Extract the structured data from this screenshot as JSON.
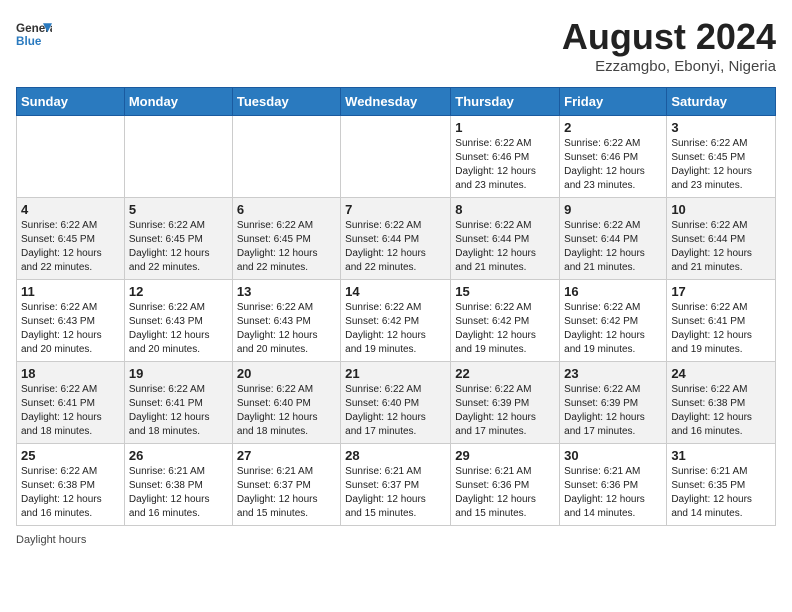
{
  "header": {
    "logo_line1": "General",
    "logo_line2": "Blue",
    "title": "August 2024",
    "subtitle": "Ezzamgbo, Ebonyi, Nigeria"
  },
  "columns": [
    "Sunday",
    "Monday",
    "Tuesday",
    "Wednesday",
    "Thursday",
    "Friday",
    "Saturday"
  ],
  "weeks": [
    [
      {
        "day": "",
        "info": ""
      },
      {
        "day": "",
        "info": ""
      },
      {
        "day": "",
        "info": ""
      },
      {
        "day": "",
        "info": ""
      },
      {
        "day": "1",
        "info": "Sunrise: 6:22 AM\nSunset: 6:46 PM\nDaylight: 12 hours\nand 23 minutes."
      },
      {
        "day": "2",
        "info": "Sunrise: 6:22 AM\nSunset: 6:46 PM\nDaylight: 12 hours\nand 23 minutes."
      },
      {
        "day": "3",
        "info": "Sunrise: 6:22 AM\nSunset: 6:45 PM\nDaylight: 12 hours\nand 23 minutes."
      }
    ],
    [
      {
        "day": "4",
        "info": "Sunrise: 6:22 AM\nSunset: 6:45 PM\nDaylight: 12 hours\nand 22 minutes."
      },
      {
        "day": "5",
        "info": "Sunrise: 6:22 AM\nSunset: 6:45 PM\nDaylight: 12 hours\nand 22 minutes."
      },
      {
        "day": "6",
        "info": "Sunrise: 6:22 AM\nSunset: 6:45 PM\nDaylight: 12 hours\nand 22 minutes."
      },
      {
        "day": "7",
        "info": "Sunrise: 6:22 AM\nSunset: 6:44 PM\nDaylight: 12 hours\nand 22 minutes."
      },
      {
        "day": "8",
        "info": "Sunrise: 6:22 AM\nSunset: 6:44 PM\nDaylight: 12 hours\nand 21 minutes."
      },
      {
        "day": "9",
        "info": "Sunrise: 6:22 AM\nSunset: 6:44 PM\nDaylight: 12 hours\nand 21 minutes."
      },
      {
        "day": "10",
        "info": "Sunrise: 6:22 AM\nSunset: 6:44 PM\nDaylight: 12 hours\nand 21 minutes."
      }
    ],
    [
      {
        "day": "11",
        "info": "Sunrise: 6:22 AM\nSunset: 6:43 PM\nDaylight: 12 hours\nand 20 minutes."
      },
      {
        "day": "12",
        "info": "Sunrise: 6:22 AM\nSunset: 6:43 PM\nDaylight: 12 hours\nand 20 minutes."
      },
      {
        "day": "13",
        "info": "Sunrise: 6:22 AM\nSunset: 6:43 PM\nDaylight: 12 hours\nand 20 minutes."
      },
      {
        "day": "14",
        "info": "Sunrise: 6:22 AM\nSunset: 6:42 PM\nDaylight: 12 hours\nand 19 minutes."
      },
      {
        "day": "15",
        "info": "Sunrise: 6:22 AM\nSunset: 6:42 PM\nDaylight: 12 hours\nand 19 minutes."
      },
      {
        "day": "16",
        "info": "Sunrise: 6:22 AM\nSunset: 6:42 PM\nDaylight: 12 hours\nand 19 minutes."
      },
      {
        "day": "17",
        "info": "Sunrise: 6:22 AM\nSunset: 6:41 PM\nDaylight: 12 hours\nand 19 minutes."
      }
    ],
    [
      {
        "day": "18",
        "info": "Sunrise: 6:22 AM\nSunset: 6:41 PM\nDaylight: 12 hours\nand 18 minutes."
      },
      {
        "day": "19",
        "info": "Sunrise: 6:22 AM\nSunset: 6:41 PM\nDaylight: 12 hours\nand 18 minutes."
      },
      {
        "day": "20",
        "info": "Sunrise: 6:22 AM\nSunset: 6:40 PM\nDaylight: 12 hours\nand 18 minutes."
      },
      {
        "day": "21",
        "info": "Sunrise: 6:22 AM\nSunset: 6:40 PM\nDaylight: 12 hours\nand 17 minutes."
      },
      {
        "day": "22",
        "info": "Sunrise: 6:22 AM\nSunset: 6:39 PM\nDaylight: 12 hours\nand 17 minutes."
      },
      {
        "day": "23",
        "info": "Sunrise: 6:22 AM\nSunset: 6:39 PM\nDaylight: 12 hours\nand 17 minutes."
      },
      {
        "day": "24",
        "info": "Sunrise: 6:22 AM\nSunset: 6:38 PM\nDaylight: 12 hours\nand 16 minutes."
      }
    ],
    [
      {
        "day": "25",
        "info": "Sunrise: 6:22 AM\nSunset: 6:38 PM\nDaylight: 12 hours\nand 16 minutes."
      },
      {
        "day": "26",
        "info": "Sunrise: 6:21 AM\nSunset: 6:38 PM\nDaylight: 12 hours\nand 16 minutes."
      },
      {
        "day": "27",
        "info": "Sunrise: 6:21 AM\nSunset: 6:37 PM\nDaylight: 12 hours\nand 15 minutes."
      },
      {
        "day": "28",
        "info": "Sunrise: 6:21 AM\nSunset: 6:37 PM\nDaylight: 12 hours\nand 15 minutes."
      },
      {
        "day": "29",
        "info": "Sunrise: 6:21 AM\nSunset: 6:36 PM\nDaylight: 12 hours\nand 15 minutes."
      },
      {
        "day": "30",
        "info": "Sunrise: 6:21 AM\nSunset: 6:36 PM\nDaylight: 12 hours\nand 14 minutes."
      },
      {
        "day": "31",
        "info": "Sunrise: 6:21 AM\nSunset: 6:35 PM\nDaylight: 12 hours\nand 14 minutes."
      }
    ]
  ],
  "footer": {
    "label": "Daylight hours"
  }
}
